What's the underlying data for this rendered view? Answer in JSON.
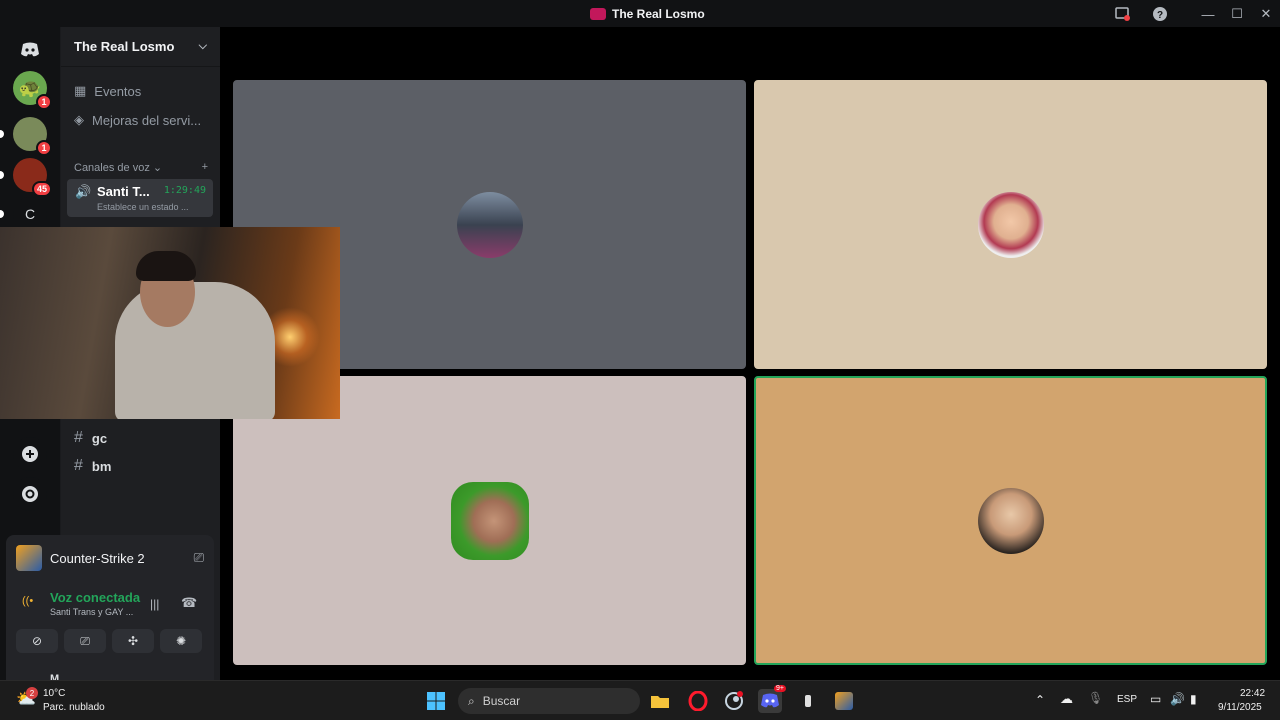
{
  "window": {
    "title": "The Real Losmo"
  },
  "server": {
    "name": "The Real Losmo"
  },
  "guilds": [
    {
      "name": "C",
      "badge": ""
    },
    {
      "name": "",
      "badge": "1"
    },
    {
      "name": "",
      "badge": "1"
    },
    {
      "name": "",
      "badge": "45"
    }
  ],
  "sidebar": {
    "events": "Eventos",
    "boosts": "Mejoras del servi...",
    "voice_category": "Canales de voz",
    "voice_channel": {
      "name": "Santi T...",
      "time": "1:29:49",
      "status": "Establece un estado ..."
    },
    "text_channels": [
      {
        "name": "gc"
      },
      {
        "name": "bm"
      }
    ]
  },
  "panel": {
    "game": "Counter-Strike 2",
    "voice_status": "Voz conectada",
    "voice_channel": "Santi Trans y GAY ...",
    "user_initial": "M"
  },
  "tiles": [
    {
      "color": "#5c5f66",
      "border": "#5c5f66"
    },
    {
      "color": "#d9c8ae",
      "border": "#d9c8ae"
    },
    {
      "color": "#ccbfbd",
      "border": "#ccbfbd"
    },
    {
      "color": "#d2a46e",
      "border": "#23a55a"
    }
  ],
  "taskbar": {
    "weather_temp": "10°C",
    "weather_desc": "Parc. nublado",
    "weather_badge": "2",
    "search_placeholder": "Buscar",
    "discord_badge": "9+",
    "lang": "ESP",
    "time": "22:42",
    "date": "9/11/2025"
  },
  "colors": {
    "accent_green": "#23a55a",
    "badge_red": "#f23f43"
  }
}
